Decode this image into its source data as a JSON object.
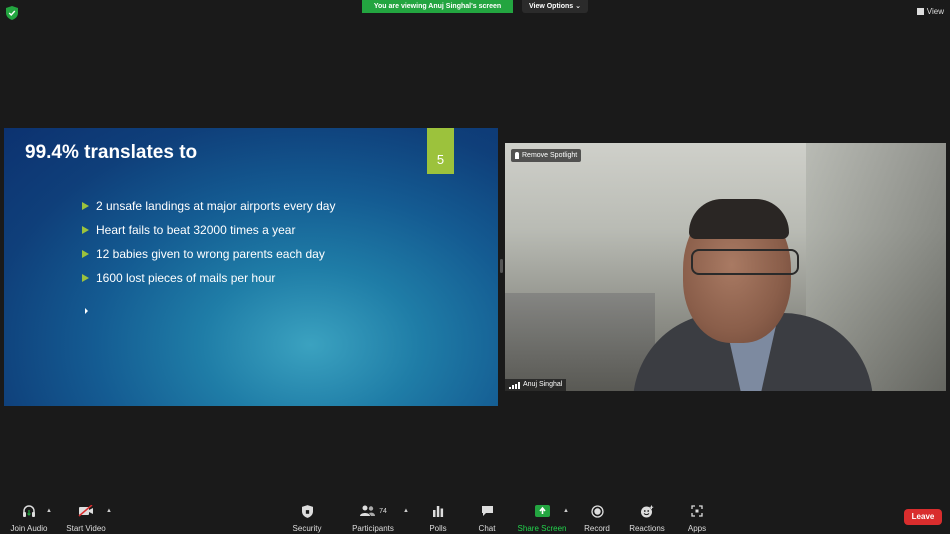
{
  "top_bar": {
    "viewing_banner": "You are viewing Anuj Singhal's screen",
    "view_options": "View Options",
    "view_button": "View",
    "banner_color": "#23a540"
  },
  "slide": {
    "title": "99.4% translates to",
    "number": "5",
    "bullets": [
      "2 unsafe landings at major airports every day",
      "Heart fails to beat 32000 times a year",
      "12 babies given to wrong parents each day",
      "1600 lost pieces of mails per hour"
    ],
    "accent_color": "#9cc23c"
  },
  "video": {
    "remove_spotlight": "Remove Spotlight",
    "participant_name": "Anuj Singhal"
  },
  "toolbar": {
    "join_audio": "Join Audio",
    "start_video": "Start Video",
    "security": "Security",
    "participants": "Participants",
    "participant_count": "74",
    "polls": "Polls",
    "chat": "Chat",
    "share_screen": "Share Screen",
    "record": "Record",
    "reactions": "Reactions",
    "apps": "Apps",
    "leave": "Leave",
    "share_color": "#23a540",
    "leave_color": "#d92d2d"
  },
  "icons": {
    "security_status": "shield-icon",
    "join_audio": "headphones-icon",
    "start_video": "video-off-icon",
    "security": "shield-icon",
    "participants": "people-icon",
    "polls": "bar-chart-icon",
    "chat": "chat-bubble-icon",
    "share_screen": "share-arrow-icon",
    "record": "record-icon",
    "reactions": "smiley-icon",
    "apps": "apps-icon"
  }
}
